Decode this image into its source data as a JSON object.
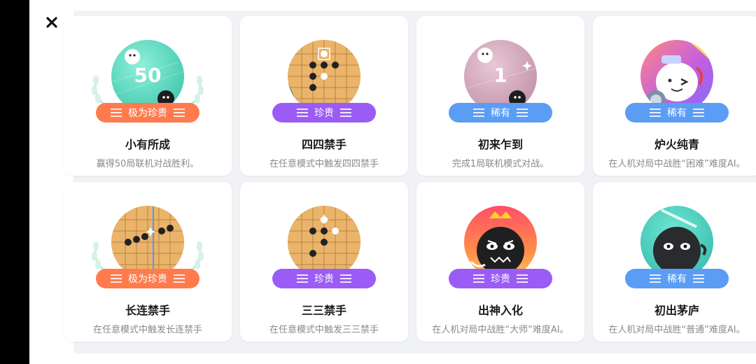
{
  "close": {
    "icon": "close-icon"
  },
  "cards": [
    {
      "title": "小有所成",
      "desc": "赢得50局联机对战胜利。",
      "rarity": "极为珍贵",
      "badge_text": "50",
      "colors": [
        "#6ee0c7",
        "#3bc0a6"
      ]
    },
    {
      "title": "四四禁手",
      "desc": "在任意模式中触发四四禁手",
      "rarity": "珍贵",
      "badge_text": "",
      "colors": [
        "#f0bf7a",
        "#d79c55"
      ]
    },
    {
      "title": "初来乍到",
      "desc": "完成1局联机模式对战。",
      "rarity": "稀有",
      "badge_text": "1",
      "colors": [
        "#d8b0c0",
        "#b98aa0"
      ]
    },
    {
      "title": "炉火纯青",
      "desc": "在人机对局中战胜“困难”难度AI。",
      "rarity": "稀有",
      "badge_text": "",
      "colors": [
        "#ff8a80",
        "#a070ff"
      ]
    },
    {
      "title": "长连禁手",
      "desc": "在任意模式中触发长连禁手",
      "rarity": "极为珍贵",
      "badge_text": "",
      "colors": [
        "#f0bf7a",
        "#d79c55"
      ]
    },
    {
      "title": "三三禁手",
      "desc": "在任意模式中触发三三禁手",
      "rarity": "珍贵",
      "badge_text": "",
      "colors": [
        "#f0bf7a",
        "#d79c55"
      ]
    },
    {
      "title": "出神入化",
      "desc": "在人机对局中战胜“大师”难度AI。",
      "rarity": "珍贵",
      "badge_text": "",
      "colors": [
        "#ff5a6a",
        "#ffb050"
      ]
    },
    {
      "title": "初出茅庐",
      "desc": "在人机对局中战胜“普通”难度AI。",
      "rarity": "稀有",
      "badge_text": "",
      "colors": [
        "#4fd6c4",
        "#32b2a6"
      ]
    }
  ]
}
